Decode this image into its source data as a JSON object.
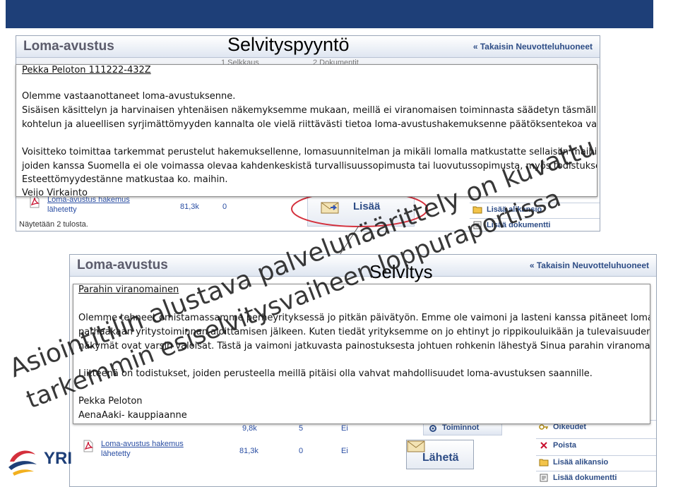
{
  "top_screenshot": {
    "app_title": "Loma-avustus",
    "back_link": "« Takaisin Neuvotteluhuoneet",
    "tabs": [
      "1 Selkkaus",
      "2 Dokumentit"
    ],
    "file_name": "Loma-avustus hakemus",
    "file_status": "lähetetty",
    "file_size": "81,3k",
    "file_count": "0",
    "footer": "Näytetään 2 tulosta.",
    "send_button": "Lisää",
    "side_buttons": [
      "Lisää alikansio",
      "Lisää dokumentti"
    ]
  },
  "request_panel": {
    "heading": "Selvityspyyntö",
    "recipient": "Pekka Peloton  111222-432Z",
    "paragraph1": "Olemme vastaanottaneet loma-avustuksenne.",
    "paragraph2_line1": "Sisäisen käsittelyn ja harvinaisen yhtenäisen näkemyksemme mukaan, meillä ei viranomaisen toiminnasta säädetyn täsmällisen",
    "paragraph2_line2": "kohtelun ja alueellisen syrjimättömyyden kannalta  ole vielä riittävästi tietoa loma-avustushakemuksenne päätöksentekoa varten.",
    "paragraph3_line1": "Voisitteko toimittaa tarkemmat perustelut hakemuksellenne, lomasuunnitelman ja mikäli lomalla matkustatte sellaisiin maihin,",
    "paragraph3_line2": "joiden kanssa Suomella ei ole voimassa olevaa kahdenkeskistä turvallisuussopimusta tai luovutussopimusta, myös todistuksen",
    "paragraph3_line3": "Esteettömyydestänne matkustaa ko. maihin.",
    "signature": "Veijo Virkainto"
  },
  "bottom_screenshot": {
    "app_title": "Loma-avustus",
    "back_link": "« Takaisin Neuvotteluhuoneet",
    "row1_size": "9,8k",
    "row1_count": "5",
    "row1_flag": "Ei",
    "file_name": "Loma-avustus hakemus",
    "file_status": "lähetetty",
    "file_size": "81,3k",
    "file_count": "0",
    "file_flag": "Ei",
    "toiminnot": "Toiminnot",
    "send_button": "Lähetä",
    "side_buttons": [
      "Oikeudet",
      "Poista",
      "Lisää alikansio",
      "Lisää dokumentti"
    ],
    "logo_text": "YRI"
  },
  "reply_panel": {
    "heading": "Selvitys",
    "salutation": "Parahin viranomainen",
    "line1": "Olemme tehneet  omistamassamme perheyrityksessä jo pitkän päivätyön. Emme ole vaimoni ja lasteni kanssa pitäneet lomaa",
    "line2": "parhaakaan yritystoiminnan aloittamisen jälkeen. Kuten tiedät yrityksemme on jo ehtinyt jo rippikouluikään ja tulevaisuuden",
    "line3": "näkymät ovat varsin valoisat. Tästä ja vaimoni jatkuvasta painostuksesta johtuen  rohkenin lähestyä Sinua parahin viranomainen",
    "line4": "Liitteenä on todistukset, joiden perusteella meillä pitäisi olla vahvat mahdollisuudet  loma-avustuksen saannille.",
    "signature_name": "Pekka Peloton",
    "signature_title": "AenaAaki- kauppiaanne"
  },
  "watermark": {
    "line1": "Asiointitilin alustava palvelunäärittely on kuvattu",
    "line2": "tarkemmin esiselvitysvaiheen loppuraportissa"
  },
  "colors": {
    "accent_blue": "#2e4d86",
    "link_blue": "#2a4ea3",
    "highlight_red": "#d4303c",
    "topbar": "#1e3f78"
  }
}
